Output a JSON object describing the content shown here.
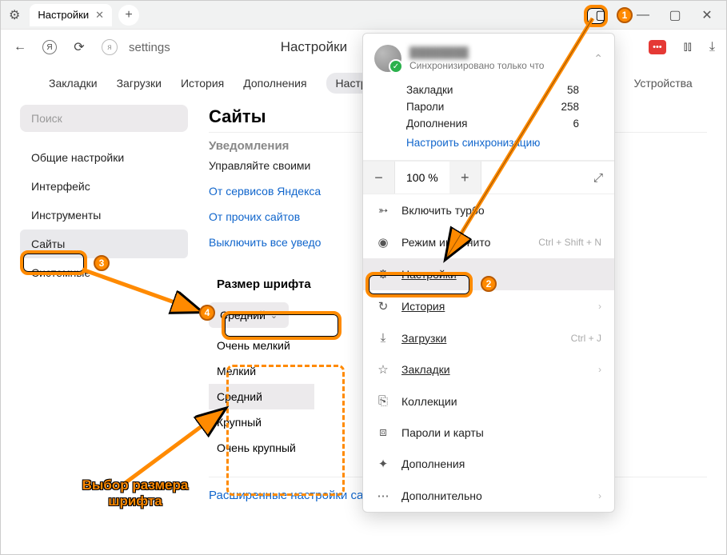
{
  "titlebar": {
    "tab_title": "Настройки",
    "close": "✕",
    "new_tab": "+"
  },
  "toolbar": {
    "url": "settings",
    "page_heading": "Настройки"
  },
  "nav": {
    "items": [
      "Закладки",
      "Загрузки",
      "История",
      "Дополнения",
      "Настройки",
      "Устройства"
    ],
    "active_visible": "Настро"
  },
  "sidebar": {
    "search_placeholder": "Поиск",
    "items": [
      "Общие настройки",
      "Интерфейс",
      "Инструменты",
      "Сайты",
      "Системные"
    ],
    "active_index": 3
  },
  "content": {
    "section_title": "Сайты",
    "notifications_label": "Уведомления",
    "manage": "Управляйте своими",
    "from_yandex": "От сервисов Яндекса",
    "from_other": "От прочих сайтов",
    "disable_all": "Выключить все уведо",
    "font_size_label": "Размер шрифта",
    "current_font": "Средний",
    "font_options": [
      "Очень мелкий",
      "Мелкий",
      "Средний",
      "Крупный",
      "Очень крупный"
    ],
    "advanced_link": "Расширенные настройки сайтов"
  },
  "menu": {
    "profile_name": "████████",
    "sync_status": "Синхронизировано только что",
    "stats": {
      "bookmarks_label": "Закладки",
      "bookmarks": "58",
      "passwords_label": "Пароли",
      "passwords": "258",
      "addons_label": "Дополнения",
      "addons": "6"
    },
    "sync_link": "Настроить синхронизацию",
    "zoom_value": "100 %",
    "items": {
      "turbo": "Включить турбо",
      "incognito": "Режим инкогнито",
      "incognito_short": "Ctrl + Shift + N",
      "settings": "Настройки",
      "history": "История",
      "downloads": "Загрузки",
      "downloads_short": "Ctrl + J",
      "bookmarks": "Закладки",
      "collections": "Коллекции",
      "passwords": "Пароли и карты",
      "addons": "Дополнения",
      "more": "Дополнительно"
    }
  },
  "annotation": {
    "caption": "Выбор размера шрифта",
    "m1": "1",
    "m2": "2",
    "m3": "3",
    "m4": "4"
  }
}
